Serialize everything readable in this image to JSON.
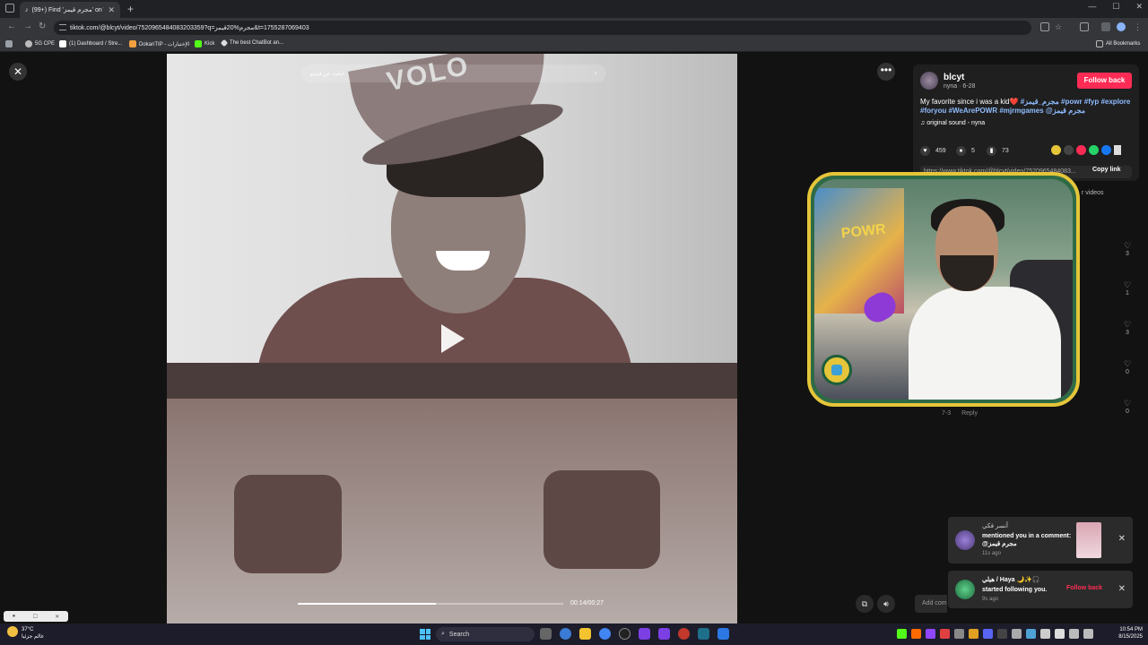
{
  "browser": {
    "tab_title": "(99+) Find 'مجرم قيمز' on TikTo...",
    "url": "tiktok.com/@blcyt/video/7520965484083203359?q=مجرم%20قيمز&t=1755287069403",
    "bookmarks": [
      "5G CPE",
      "(1) Dashboard / Stre...",
      "DokanTIP - الإختيارات",
      "Kick",
      "The best ChatBot an..."
    ],
    "all_bookmarks": "All Bookmarks"
  },
  "video": {
    "search_placeholder": "ابحث عن فيديو",
    "cap_text": "VOLO",
    "timecode": "00:14/00:27",
    "progress": 0.52
  },
  "post": {
    "username": "blcyt",
    "subtitle": "nyna · 6-28",
    "follow_label": "Follow back",
    "caption_text": "My favorite since i was a kid❤️ ",
    "caption_tags": "#مجرم_قيمز #powr #fyp #explore #foryou #WeArePOWR #mjrmgames @مجرم قيمز",
    "music": "♫  original sound - nyna",
    "likes": "459",
    "comments": "5",
    "saves": "73",
    "link": "https://www.tiktok.com/@blcyt/video/7520965484083...",
    "copy_link": "Copy link",
    "videos_tab": "r videos"
  },
  "comment_likes": [
    "3",
    "1",
    "3",
    "0",
    "0"
  ],
  "comment_meta": {
    "date": "7-3",
    "reply": "Reply"
  },
  "add_comment": "Add comm",
  "notifications": [
    {
      "name": "أنسر فكي",
      "message": "mentioned you in a comment: @مجرم قيمز",
      "time": "11s ago"
    },
    {
      "name": "هيلي / Haya 🌙✨🎧",
      "message": "started following you.",
      "time": "9s ago",
      "action": "Follow back"
    }
  ],
  "taskbar": {
    "weather_temp": "37°C",
    "weather_desc": "غالم جزئيا",
    "search_label": "Search",
    "time": "10:54 PM",
    "date": "8/15/2025"
  }
}
